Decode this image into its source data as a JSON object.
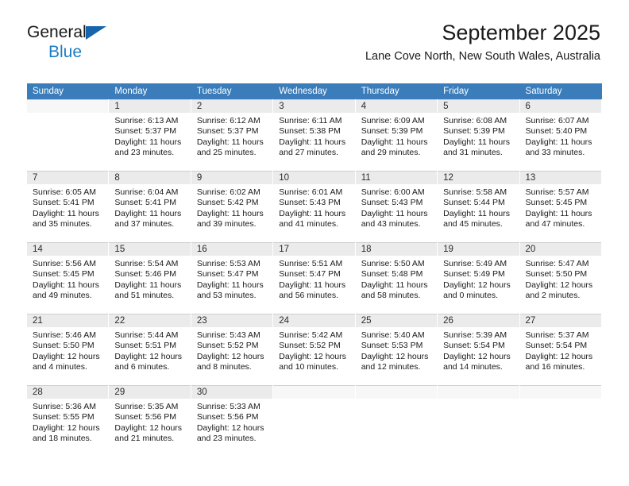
{
  "brand": {
    "name_part1": "General",
    "name_part2": "Blue",
    "triangle_icon": "triangle-logo-icon",
    "color_dark": "#1a1a1a",
    "color_blue": "#1d7dc4"
  },
  "header": {
    "title": "September 2025",
    "subtitle": "Lane Cove North, New South Wales, Australia"
  },
  "theme": {
    "header_row_bg": "#3a7dba",
    "header_row_text": "#ffffff",
    "daynum_bg": "#ebebeb",
    "row_band_bg": "#f6f6f6"
  },
  "calendar": {
    "weekday_headers": [
      "Sunday",
      "Monday",
      "Tuesday",
      "Wednesday",
      "Thursday",
      "Friday",
      "Saturday"
    ],
    "weeks": [
      [
        {
          "day": "",
          "sunrise": "",
          "sunset": "",
          "daylight_line1": "",
          "daylight_line2": ""
        },
        {
          "day": "1",
          "sunrise": "Sunrise: 6:13 AM",
          "sunset": "Sunset: 5:37 PM",
          "daylight_line1": "Daylight: 11 hours",
          "daylight_line2": "and 23 minutes."
        },
        {
          "day": "2",
          "sunrise": "Sunrise: 6:12 AM",
          "sunset": "Sunset: 5:37 PM",
          "daylight_line1": "Daylight: 11 hours",
          "daylight_line2": "and 25 minutes."
        },
        {
          "day": "3",
          "sunrise": "Sunrise: 6:11 AM",
          "sunset": "Sunset: 5:38 PM",
          "daylight_line1": "Daylight: 11 hours",
          "daylight_line2": "and 27 minutes."
        },
        {
          "day": "4",
          "sunrise": "Sunrise: 6:09 AM",
          "sunset": "Sunset: 5:39 PM",
          "daylight_line1": "Daylight: 11 hours",
          "daylight_line2": "and 29 minutes."
        },
        {
          "day": "5",
          "sunrise": "Sunrise: 6:08 AM",
          "sunset": "Sunset: 5:39 PM",
          "daylight_line1": "Daylight: 11 hours",
          "daylight_line2": "and 31 minutes."
        },
        {
          "day": "6",
          "sunrise": "Sunrise: 6:07 AM",
          "sunset": "Sunset: 5:40 PM",
          "daylight_line1": "Daylight: 11 hours",
          "daylight_line2": "and 33 minutes."
        }
      ],
      [
        {
          "day": "7",
          "sunrise": "Sunrise: 6:05 AM",
          "sunset": "Sunset: 5:41 PM",
          "daylight_line1": "Daylight: 11 hours",
          "daylight_line2": "and 35 minutes."
        },
        {
          "day": "8",
          "sunrise": "Sunrise: 6:04 AM",
          "sunset": "Sunset: 5:41 PM",
          "daylight_line1": "Daylight: 11 hours",
          "daylight_line2": "and 37 minutes."
        },
        {
          "day": "9",
          "sunrise": "Sunrise: 6:02 AM",
          "sunset": "Sunset: 5:42 PM",
          "daylight_line1": "Daylight: 11 hours",
          "daylight_line2": "and 39 minutes."
        },
        {
          "day": "10",
          "sunrise": "Sunrise: 6:01 AM",
          "sunset": "Sunset: 5:43 PM",
          "daylight_line1": "Daylight: 11 hours",
          "daylight_line2": "and 41 minutes."
        },
        {
          "day": "11",
          "sunrise": "Sunrise: 6:00 AM",
          "sunset": "Sunset: 5:43 PM",
          "daylight_line1": "Daylight: 11 hours",
          "daylight_line2": "and 43 minutes."
        },
        {
          "day": "12",
          "sunrise": "Sunrise: 5:58 AM",
          "sunset": "Sunset: 5:44 PM",
          "daylight_line1": "Daylight: 11 hours",
          "daylight_line2": "and 45 minutes."
        },
        {
          "day": "13",
          "sunrise": "Sunrise: 5:57 AM",
          "sunset": "Sunset: 5:45 PM",
          "daylight_line1": "Daylight: 11 hours",
          "daylight_line2": "and 47 minutes."
        }
      ],
      [
        {
          "day": "14",
          "sunrise": "Sunrise: 5:56 AM",
          "sunset": "Sunset: 5:45 PM",
          "daylight_line1": "Daylight: 11 hours",
          "daylight_line2": "and 49 minutes."
        },
        {
          "day": "15",
          "sunrise": "Sunrise: 5:54 AM",
          "sunset": "Sunset: 5:46 PM",
          "daylight_line1": "Daylight: 11 hours",
          "daylight_line2": "and 51 minutes."
        },
        {
          "day": "16",
          "sunrise": "Sunrise: 5:53 AM",
          "sunset": "Sunset: 5:47 PM",
          "daylight_line1": "Daylight: 11 hours",
          "daylight_line2": "and 53 minutes."
        },
        {
          "day": "17",
          "sunrise": "Sunrise: 5:51 AM",
          "sunset": "Sunset: 5:47 PM",
          "daylight_line1": "Daylight: 11 hours",
          "daylight_line2": "and 56 minutes."
        },
        {
          "day": "18",
          "sunrise": "Sunrise: 5:50 AM",
          "sunset": "Sunset: 5:48 PM",
          "daylight_line1": "Daylight: 11 hours",
          "daylight_line2": "and 58 minutes."
        },
        {
          "day": "19",
          "sunrise": "Sunrise: 5:49 AM",
          "sunset": "Sunset: 5:49 PM",
          "daylight_line1": "Daylight: 12 hours",
          "daylight_line2": "and 0 minutes."
        },
        {
          "day": "20",
          "sunrise": "Sunrise: 5:47 AM",
          "sunset": "Sunset: 5:50 PM",
          "daylight_line1": "Daylight: 12 hours",
          "daylight_line2": "and 2 minutes."
        }
      ],
      [
        {
          "day": "21",
          "sunrise": "Sunrise: 5:46 AM",
          "sunset": "Sunset: 5:50 PM",
          "daylight_line1": "Daylight: 12 hours",
          "daylight_line2": "and 4 minutes."
        },
        {
          "day": "22",
          "sunrise": "Sunrise: 5:44 AM",
          "sunset": "Sunset: 5:51 PM",
          "daylight_line1": "Daylight: 12 hours",
          "daylight_line2": "and 6 minutes."
        },
        {
          "day": "23",
          "sunrise": "Sunrise: 5:43 AM",
          "sunset": "Sunset: 5:52 PM",
          "daylight_line1": "Daylight: 12 hours",
          "daylight_line2": "and 8 minutes."
        },
        {
          "day": "24",
          "sunrise": "Sunrise: 5:42 AM",
          "sunset": "Sunset: 5:52 PM",
          "daylight_line1": "Daylight: 12 hours",
          "daylight_line2": "and 10 minutes."
        },
        {
          "day": "25",
          "sunrise": "Sunrise: 5:40 AM",
          "sunset": "Sunset: 5:53 PM",
          "daylight_line1": "Daylight: 12 hours",
          "daylight_line2": "and 12 minutes."
        },
        {
          "day": "26",
          "sunrise": "Sunrise: 5:39 AM",
          "sunset": "Sunset: 5:54 PM",
          "daylight_line1": "Daylight: 12 hours",
          "daylight_line2": "and 14 minutes."
        },
        {
          "day": "27",
          "sunrise": "Sunrise: 5:37 AM",
          "sunset": "Sunset: 5:54 PM",
          "daylight_line1": "Daylight: 12 hours",
          "daylight_line2": "and 16 minutes."
        }
      ],
      [
        {
          "day": "28",
          "sunrise": "Sunrise: 5:36 AM",
          "sunset": "Sunset: 5:55 PM",
          "daylight_line1": "Daylight: 12 hours",
          "daylight_line2": "and 18 minutes."
        },
        {
          "day": "29",
          "sunrise": "Sunrise: 5:35 AM",
          "sunset": "Sunset: 5:56 PM",
          "daylight_line1": "Daylight: 12 hours",
          "daylight_line2": "and 21 minutes."
        },
        {
          "day": "30",
          "sunrise": "Sunrise: 5:33 AM",
          "sunset": "Sunset: 5:56 PM",
          "daylight_line1": "Daylight: 12 hours",
          "daylight_line2": "and 23 minutes."
        },
        {
          "day": "",
          "sunrise": "",
          "sunset": "",
          "daylight_line1": "",
          "daylight_line2": ""
        },
        {
          "day": "",
          "sunrise": "",
          "sunset": "",
          "daylight_line1": "",
          "daylight_line2": ""
        },
        {
          "day": "",
          "sunrise": "",
          "sunset": "",
          "daylight_line1": "",
          "daylight_line2": ""
        },
        {
          "day": "",
          "sunrise": "",
          "sunset": "",
          "daylight_line1": "",
          "daylight_line2": ""
        }
      ]
    ]
  }
}
